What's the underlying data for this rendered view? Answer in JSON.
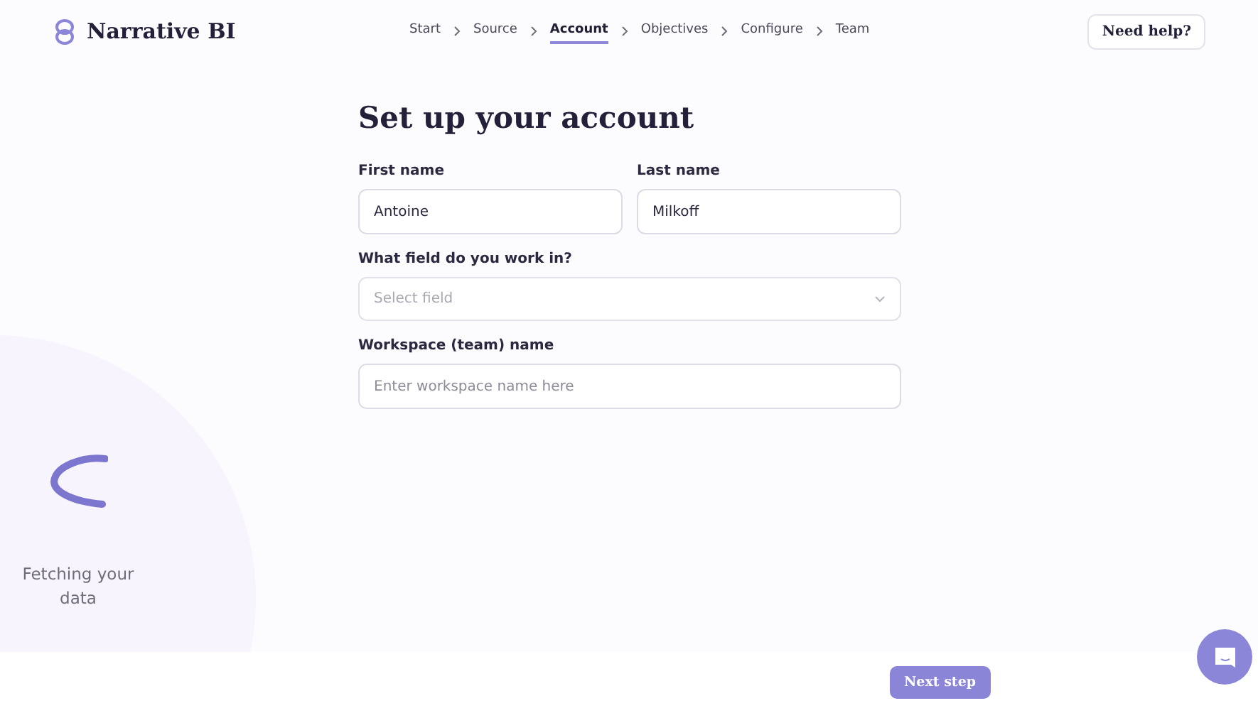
{
  "brand": {
    "name": "Narrative BI"
  },
  "steps": [
    {
      "label": "Start",
      "selected": false
    },
    {
      "label": "Source",
      "selected": false
    },
    {
      "label": "Account",
      "selected": true
    },
    {
      "label": "Objectives",
      "selected": false
    },
    {
      "label": "Configure",
      "selected": false
    },
    {
      "label": "Team",
      "selected": false
    }
  ],
  "help_button": "Need help?",
  "title": "Set up your account",
  "fields": [
    {
      "kind": "row",
      "items": [
        {
          "label": "First name",
          "value": "Antoine"
        },
        {
          "label": "Last name",
          "value": "Milkoff"
        }
      ]
    },
    {
      "kind": "select",
      "label": "What field do you work in?",
      "placeholder": "Select field"
    },
    {
      "kind": "text",
      "label": "Workspace (team) name",
      "placeholder": "Enter workspace name here"
    }
  ],
  "loader": {
    "text": "Fetching your data"
  },
  "next_button": "Next step"
}
